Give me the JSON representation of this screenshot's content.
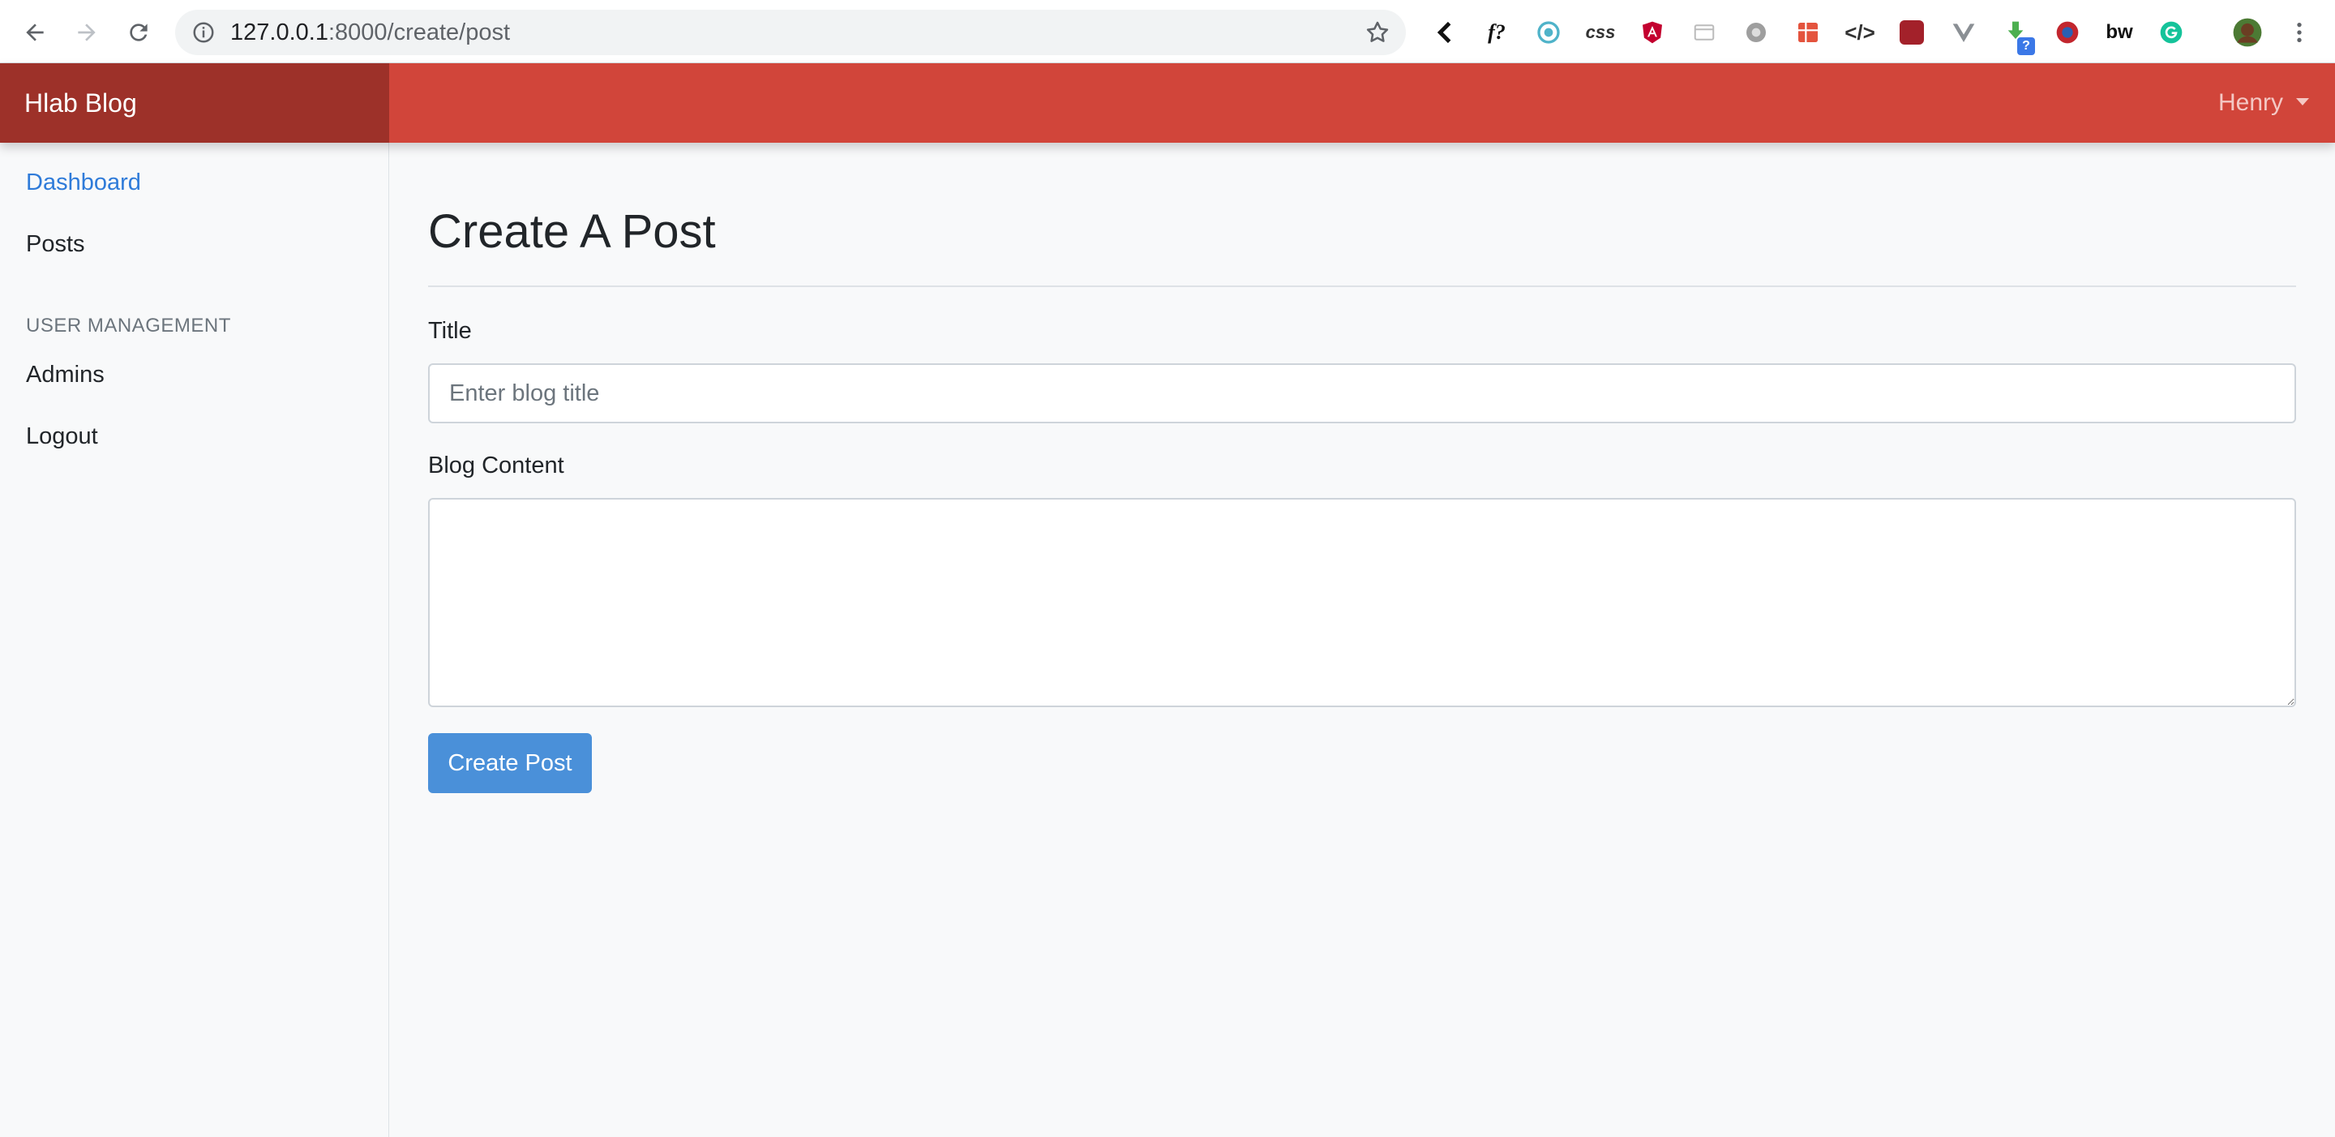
{
  "browser": {
    "url_host": "127.0.0.1",
    "url_rest": ":8000/create/post",
    "extensions": [
      "back-arrow-extension",
      "fx-extension",
      "webhint-extension",
      "css-extension",
      "angular-extension",
      "window-extension",
      "gear-extension",
      "grid-extension",
      "code-extension",
      "mendeley-extension",
      "vue-extension",
      "download-extension",
      "ball-extension",
      "bw-extension",
      "grammarly-extension"
    ],
    "ext_labels": {
      "fx": "f?",
      "css": "css",
      "code": "</>",
      "bw": "bw",
      "badge": "?"
    }
  },
  "navbar": {
    "brand": "Hlab Blog",
    "user": "Henry"
  },
  "sidebar": {
    "items": [
      {
        "label": "Dashboard",
        "active": true
      },
      {
        "label": "Posts"
      }
    ],
    "section_heading": "USER MANAGEMENT",
    "management_items": [
      {
        "label": "Admins"
      },
      {
        "label": "Logout"
      }
    ]
  },
  "main": {
    "title": "Create A Post",
    "form": {
      "title_label": "Title",
      "title_placeholder": "Enter blog title",
      "title_value": "",
      "content_label": "Blog Content",
      "content_value": "",
      "submit_label": "Create Post"
    }
  },
  "colors": {
    "navbar": "#d1453a",
    "brand_bg": "#9d3129",
    "primary_button": "#4a90d9",
    "active_link": "#2f7bd9"
  }
}
